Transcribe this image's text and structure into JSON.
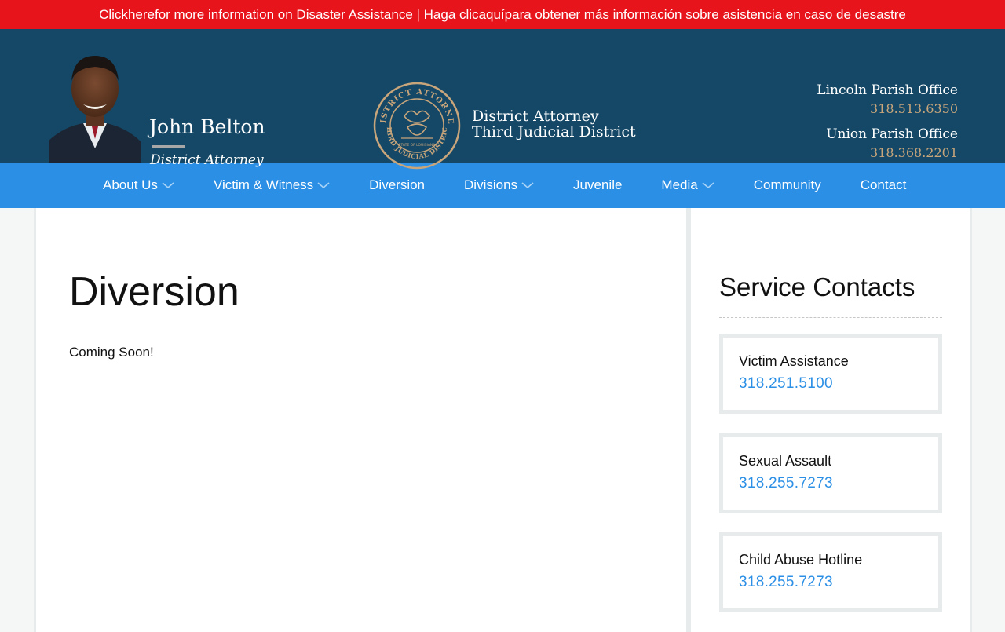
{
  "alert": {
    "pre": "Click ",
    "link_here": "here",
    "mid": " for more information on Disaster Assistance | Haga clic ",
    "link_aqui": "aquí",
    "post": " para obtener más información sobre asistencia en caso de desastre"
  },
  "header": {
    "da_name": "John Belton",
    "da_title": "District Attorney",
    "office_line1": "District Attorney",
    "office_line2": "Third Judicial District",
    "seal_top": "DISTRICT ATTORNEY",
    "seal_bottom": "THIRD JUDICIAL DISTRICT",
    "seal_inner": "STATE OF LOUISIANA",
    "offices": [
      {
        "name": "Lincoln Parish Office",
        "phone": "318.513.6350"
      },
      {
        "name": "Union Parish Office",
        "phone": "318.368.2201"
      }
    ]
  },
  "nav": {
    "items": [
      {
        "label": "About Us",
        "has_dropdown": true
      },
      {
        "label": "Victim & Witness",
        "has_dropdown": true
      },
      {
        "label": "Diversion",
        "has_dropdown": false
      },
      {
        "label": "Divisions",
        "has_dropdown": true
      },
      {
        "label": "Juvenile",
        "has_dropdown": false
      },
      {
        "label": "Media",
        "has_dropdown": true
      },
      {
        "label": "Community",
        "has_dropdown": false
      },
      {
        "label": "Contact",
        "has_dropdown": false
      }
    ]
  },
  "main": {
    "title": "Diversion",
    "body": "Coming Soon!"
  },
  "sidebar": {
    "title": "Service Contacts",
    "contacts": [
      {
        "name": "Victim Assistance",
        "phone": "318.251.5100"
      },
      {
        "name": "Sexual Assault",
        "phone": "318.255.7273"
      },
      {
        "name": "Child Abuse Hotline",
        "phone": "318.255.7273"
      }
    ]
  },
  "colors": {
    "alert_bg": "#e8141b",
    "header_bg": "#144866",
    "nav_bg": "#2b8fe5",
    "gold": "#c9a57b",
    "link_blue": "#2b8fe5"
  }
}
